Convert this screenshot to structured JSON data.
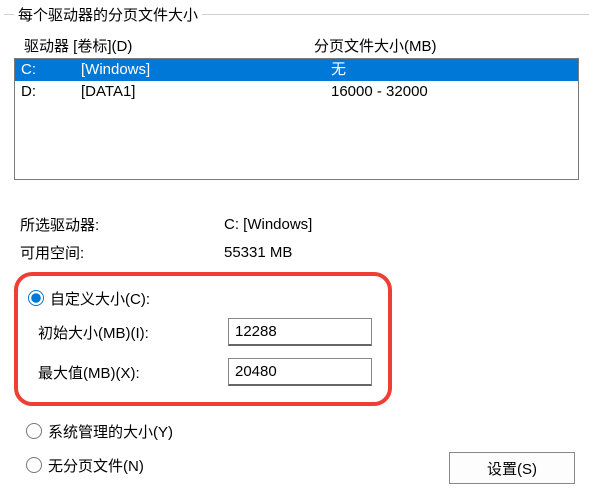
{
  "group_title": "每个驱动器的分页文件大小",
  "headers": {
    "drive": "驱动器  [卷标](D)",
    "size": "分页文件大小(MB)"
  },
  "drives": [
    {
      "letter": "C:",
      "label": "[Windows]",
      "size": "无",
      "selected": true
    },
    {
      "letter": "D:",
      "label": "[DATA1]",
      "size": "16000 - 32000",
      "selected": false
    }
  ],
  "selected_drive": {
    "label": "所选驱动器:",
    "value": "C:   [Windows]"
  },
  "free_space": {
    "label": "可用空间:",
    "value": "55331 MB"
  },
  "options": {
    "custom": {
      "label": "自定义大小(C):",
      "checked": true
    },
    "initial": {
      "label": "初始大小(MB)(I):",
      "value": "12288"
    },
    "maximum": {
      "label": "最大值(MB)(X):",
      "value": "20480"
    },
    "system": {
      "label": "系统管理的大小(Y)",
      "checked": false
    },
    "none": {
      "label": "无分页文件(N)",
      "checked": false
    }
  },
  "buttons": {
    "set": "设置(S)"
  }
}
